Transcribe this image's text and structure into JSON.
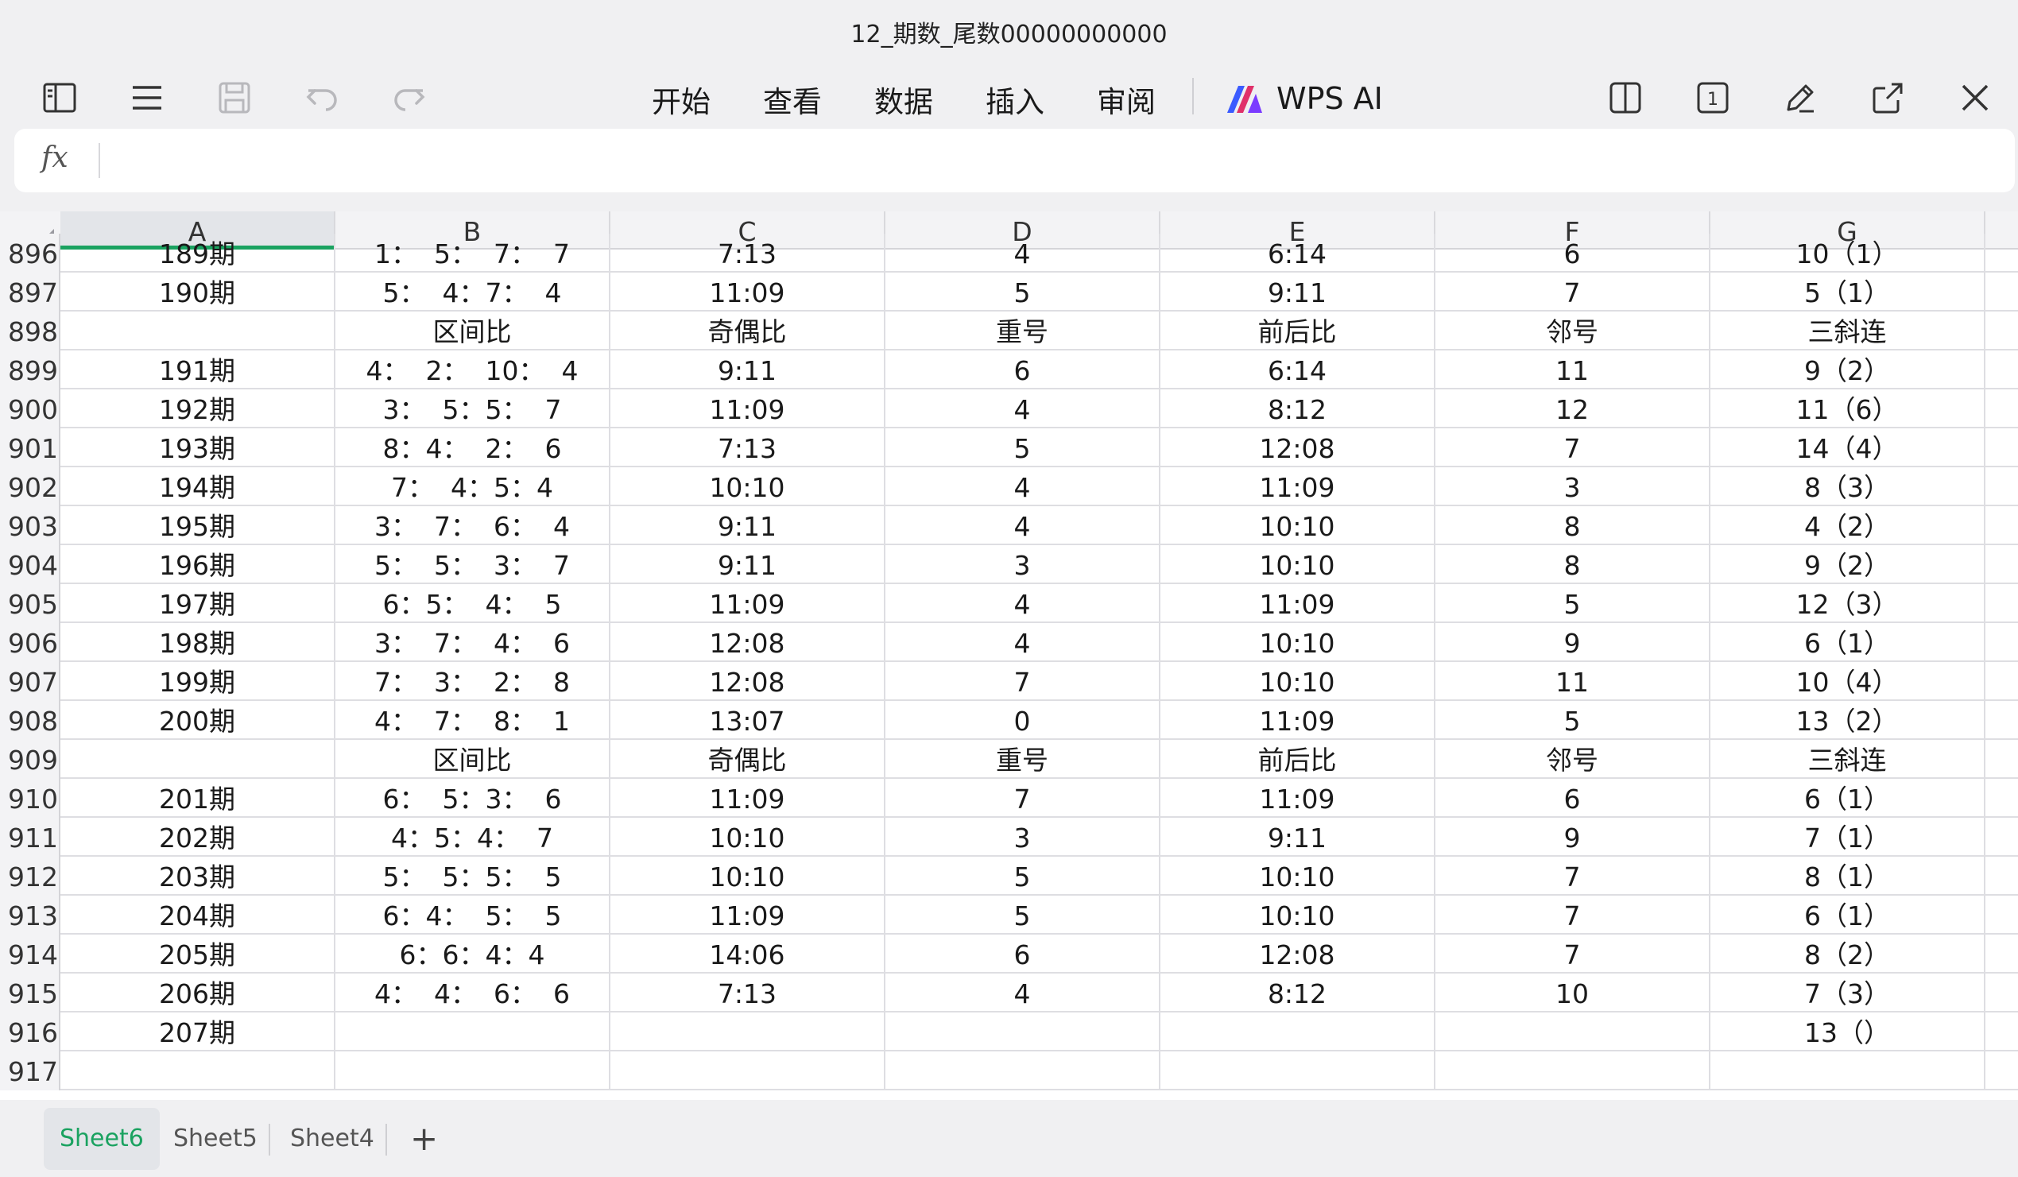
{
  "window": {
    "title": "12_期数_尾数00000000000"
  },
  "toolbar": {
    "menu": [
      "开始",
      "查看",
      "数据",
      "插入",
      "审阅"
    ],
    "ai_label": "WPS AI",
    "page_badge": "1"
  },
  "formula_bar": {
    "fx_label": "fx",
    "value": ""
  },
  "sheet": {
    "columns": [
      "A",
      "B",
      "C",
      "D",
      "E",
      "F",
      "G"
    ],
    "selected_column": "A",
    "rows": [
      {
        "num": "896",
        "cells": [
          "189期",
          "1：  5：  7：  7",
          "7:13",
          "4",
          "6:14",
          "6",
          "10（1）"
        ]
      },
      {
        "num": "897",
        "cells": [
          "190期",
          "5：  4：7：  4",
          "11:09",
          "5",
          "9:11",
          "7",
          "5（1）"
        ]
      },
      {
        "num": "898",
        "cells": [
          "",
          "区间比",
          "奇偶比",
          "重号",
          "前后比",
          "邻号",
          "三斜连"
        ]
      },
      {
        "num": "899",
        "cells": [
          "191期",
          "4：  2：  10：  4",
          "9:11",
          "6",
          "6:14",
          "11",
          "9（2）"
        ]
      },
      {
        "num": "900",
        "cells": [
          "192期",
          "3：  5：5：  7",
          "11:09",
          "4",
          "8:12",
          "12",
          "11（6）"
        ]
      },
      {
        "num": "901",
        "cells": [
          "193期",
          "8：4：  2：  6",
          "7:13",
          "5",
          "12:08",
          "7",
          "14（4）"
        ]
      },
      {
        "num": "902",
        "cells": [
          "194期",
          "7：  4：5：4",
          "10:10",
          "4",
          "11:09",
          "3",
          "8（3）"
        ]
      },
      {
        "num": "903",
        "cells": [
          "195期",
          "3：  7：  6：  4",
          "9:11",
          "4",
          "10:10",
          "8",
          "4（2）"
        ]
      },
      {
        "num": "904",
        "cells": [
          "196期",
          "5：  5：  3：  7",
          "9:11",
          "3",
          "10:10",
          "8",
          "9（2）"
        ]
      },
      {
        "num": "905",
        "cells": [
          "197期",
          "6：5：  4：  5",
          "11:09",
          "4",
          "11:09",
          "5",
          "12（3）"
        ]
      },
      {
        "num": "906",
        "cells": [
          "198期",
          "3：  7：  4：  6",
          "12:08",
          "4",
          "10:10",
          "9",
          "6（1）"
        ]
      },
      {
        "num": "907",
        "cells": [
          "199期",
          "7：  3：  2：  8",
          "12:08",
          "7",
          "10:10",
          "11",
          "10（4）"
        ]
      },
      {
        "num": "908",
        "cells": [
          "200期",
          "4：  7：  8：  1",
          "13:07",
          "0",
          "11:09",
          "5",
          "13（2）"
        ]
      },
      {
        "num": "909",
        "cells": [
          "",
          "区间比",
          "奇偶比",
          "重号",
          "前后比",
          "邻号",
          "三斜连"
        ]
      },
      {
        "num": "910",
        "cells": [
          "201期",
          "6：  5：3：  6",
          "11:09",
          "7",
          "11:09",
          "6",
          "6（1）"
        ]
      },
      {
        "num": "911",
        "cells": [
          "202期",
          "4：5：4：  7",
          "10:10",
          "3",
          "9:11",
          "9",
          "7（1）"
        ]
      },
      {
        "num": "912",
        "cells": [
          "203期",
          "5：  5：5：  5",
          "10:10",
          "5",
          "10:10",
          "7",
          "8（1）"
        ]
      },
      {
        "num": "913",
        "cells": [
          "204期",
          "6：4：  5：  5",
          "11:09",
          "5",
          "10:10",
          "7",
          "6（1）"
        ]
      },
      {
        "num": "914",
        "cells": [
          "205期",
          "6：6：4：4",
          "14:06",
          "6",
          "12:08",
          "7",
          "8（2）"
        ]
      },
      {
        "num": "915",
        "cells": [
          "206期",
          "4：  4：  6：  6",
          "7:13",
          "4",
          "8:12",
          "10",
          "7（3）"
        ]
      },
      {
        "num": "916",
        "cells": [
          "207期",
          "",
          "",
          "",
          "",
          "",
          "13（）"
        ]
      },
      {
        "num": "917",
        "cells": [
          "",
          "",
          "",
          "",
          "",
          "",
          ""
        ]
      }
    ]
  },
  "sheet_tabs": {
    "items": [
      "Sheet6",
      "Sheet5",
      "Sheet4"
    ],
    "active": "Sheet6",
    "add_label": "+"
  },
  "colors": {
    "accent": "#1aa260",
    "background": "#f0f0f2",
    "grid_line": "#dedee2"
  }
}
